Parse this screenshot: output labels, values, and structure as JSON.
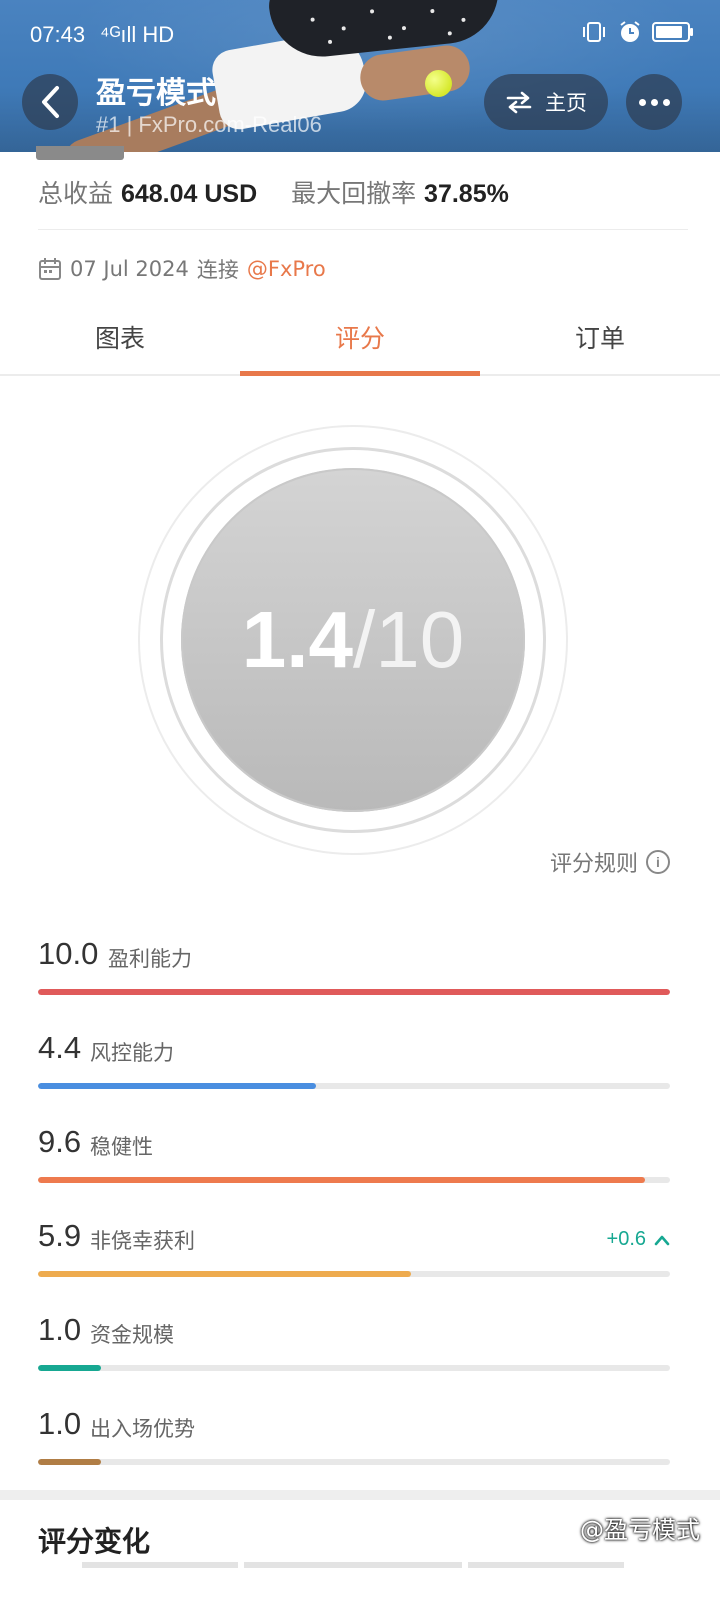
{
  "status_bar": {
    "time": "07:43",
    "signal": "⁴ᴳıll HD",
    "icons": [
      "vibrate-icon",
      "alarm-icon",
      "battery-icon"
    ]
  },
  "header": {
    "title": "盈亏模式",
    "subtitle": "#1 | FxPro.com-Real06",
    "home_label": "主页",
    "back_icon": "back-arrow-icon",
    "swap_icon": "swap-arrows-icon",
    "more_icon": "more-dots-icon"
  },
  "summary": {
    "profit_label": "总收益",
    "profit_value": "648.04 USD",
    "drawdown_label": "最大回撤率",
    "drawdown_value": "37.85%",
    "connect_date": "07 Jul 2024",
    "connect_label": "连接",
    "broker": "@FxPro"
  },
  "tabs": [
    {
      "label": "图表",
      "active": false
    },
    {
      "label": "评分",
      "active": true
    },
    {
      "label": "订单",
      "active": false
    }
  ],
  "score": {
    "value": "1.4",
    "max": "/10",
    "rules_label": "评分规则"
  },
  "metrics": [
    {
      "value": "10.0",
      "label": "盈利能力",
      "level": 1.0,
      "color": "#e05a5a"
    },
    {
      "value": "4.4",
      "label": "风控能力",
      "level": 0.44,
      "color": "#4a8ee0"
    },
    {
      "value": "9.6",
      "label": "稳健性",
      "level": 0.96,
      "color": "#ee7a4e"
    },
    {
      "value": "5.9",
      "label": "非侥幸获利",
      "level": 0.59,
      "color": "#eeab4e",
      "delta": "+0.6"
    },
    {
      "value": "1.0",
      "label": "资金规模",
      "level": 0.1,
      "color": "#17a892"
    },
    {
      "value": "1.0",
      "label": "出入场优势",
      "level": 0.1,
      "color": "#b07d45"
    }
  ],
  "section": {
    "title": "评分变化"
  },
  "watermark": "@盈亏模式",
  "colors": {
    "accent": "#e8784a",
    "up": "#17a892"
  }
}
